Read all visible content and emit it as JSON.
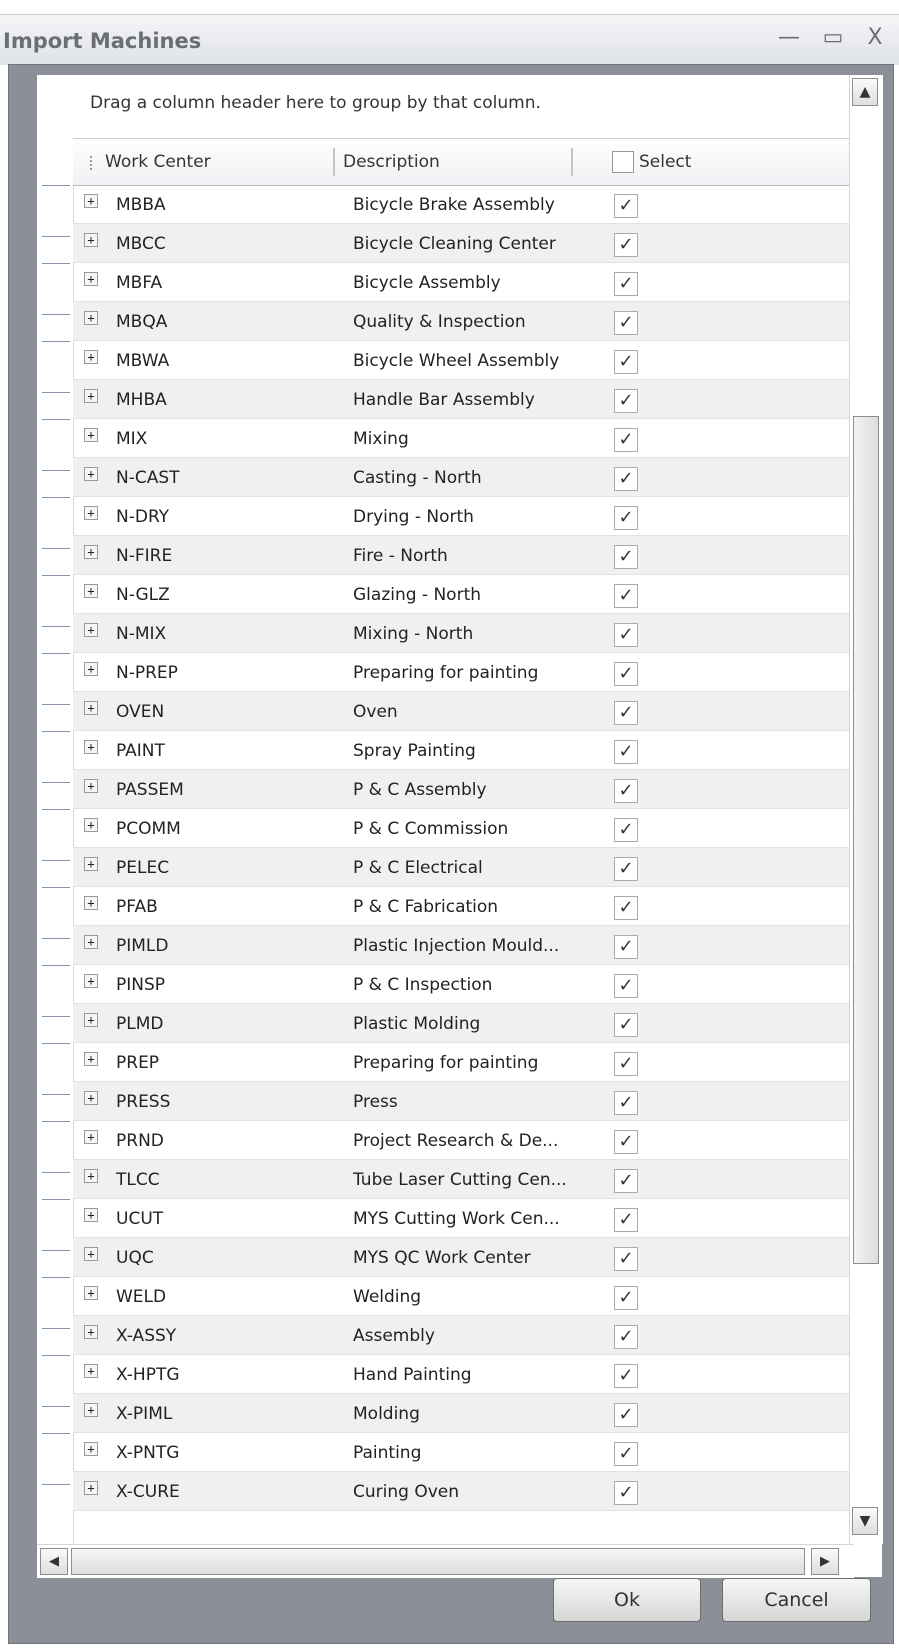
{
  "window": {
    "title": "Import Machines",
    "minimize_label": "—",
    "maximize_label": "▭",
    "close_label": "X"
  },
  "grid": {
    "group_panel_text": "Drag a column header here to group by that column.",
    "columns": {
      "work_center": "Work Center",
      "description": "Description",
      "select": "Select"
    },
    "header_select_checked": false,
    "rows": [
      {
        "work_center": "MBBA",
        "description": "Bicycle Brake Assembly",
        "selected": true
      },
      {
        "work_center": "MBCC",
        "description": "Bicycle Cleaning Center",
        "selected": true
      },
      {
        "work_center": "MBFA",
        "description": "Bicycle Assembly",
        "selected": true
      },
      {
        "work_center": "MBQA",
        "description": "Quality & Inspection",
        "selected": true
      },
      {
        "work_center": "MBWA",
        "description": "Bicycle Wheel Assembly",
        "selected": true
      },
      {
        "work_center": "MHBA",
        "description": "Handle Bar Assembly",
        "selected": true
      },
      {
        "work_center": "MIX",
        "description": "Mixing",
        "selected": true
      },
      {
        "work_center": "N-CAST",
        "description": "Casting - North",
        "selected": true
      },
      {
        "work_center": "N-DRY",
        "description": "Drying - North",
        "selected": true
      },
      {
        "work_center": "N-FIRE",
        "description": "Fire - North",
        "selected": true
      },
      {
        "work_center": "N-GLZ",
        "description": "Glazing - North",
        "selected": true
      },
      {
        "work_center": "N-MIX",
        "description": "Mixing - North",
        "selected": true
      },
      {
        "work_center": "N-PREP",
        "description": "Preparing for painting",
        "selected": true
      },
      {
        "work_center": "OVEN",
        "description": "Oven",
        "selected": true
      },
      {
        "work_center": "PAINT",
        "description": "Spray Painting",
        "selected": true
      },
      {
        "work_center": "PASSEM",
        "description": "P & C Assembly",
        "selected": true
      },
      {
        "work_center": "PCOMM",
        "description": "P & C Commission",
        "selected": true
      },
      {
        "work_center": "PELEC",
        "description": "P & C Electrical",
        "selected": true
      },
      {
        "work_center": "PFAB",
        "description": "P & C Fabrication",
        "selected": true
      },
      {
        "work_center": "PIMLD",
        "description": "Plastic Injection Mould...",
        "selected": true
      },
      {
        "work_center": "PINSP",
        "description": "P & C Inspection",
        "selected": true
      },
      {
        "work_center": "PLMD",
        "description": "Plastic Molding",
        "selected": true
      },
      {
        "work_center": "PREP",
        "description": "Preparing for painting",
        "selected": true
      },
      {
        "work_center": "PRESS",
        "description": "Press",
        "selected": true
      },
      {
        "work_center": "PRND",
        "description": "Project Research & De...",
        "selected": true
      },
      {
        "work_center": "TLCC",
        "description": "Tube Laser Cutting Cen...",
        "selected": true
      },
      {
        "work_center": "UCUT",
        "description": "MYS Cutting Work Cen...",
        "selected": true
      },
      {
        "work_center": "UQC",
        "description": "MYS QC Work Center",
        "selected": true
      },
      {
        "work_center": "WELD",
        "description": "Welding",
        "selected": true
      },
      {
        "work_center": "X-ASSY",
        "description": "Assembly",
        "selected": true
      },
      {
        "work_center": "X-HPTG",
        "description": "Hand Painting",
        "selected": true
      },
      {
        "work_center": "X-PIML",
        "description": "Molding",
        "selected": true
      },
      {
        "work_center": "X-PNTG",
        "description": "Painting",
        "selected": true
      },
      {
        "work_center": "X-CURE",
        "description": "Curing Oven",
        "selected": true
      }
    ],
    "expand_glyph": "+",
    "check_glyph": "✓"
  },
  "scrollbars": {
    "up_arrow": "▲",
    "down_arrow": "▼",
    "left_arrow": "◀",
    "right_arrow": "▶"
  },
  "buttons": {
    "ok": "Ok",
    "cancel": "Cancel"
  }
}
